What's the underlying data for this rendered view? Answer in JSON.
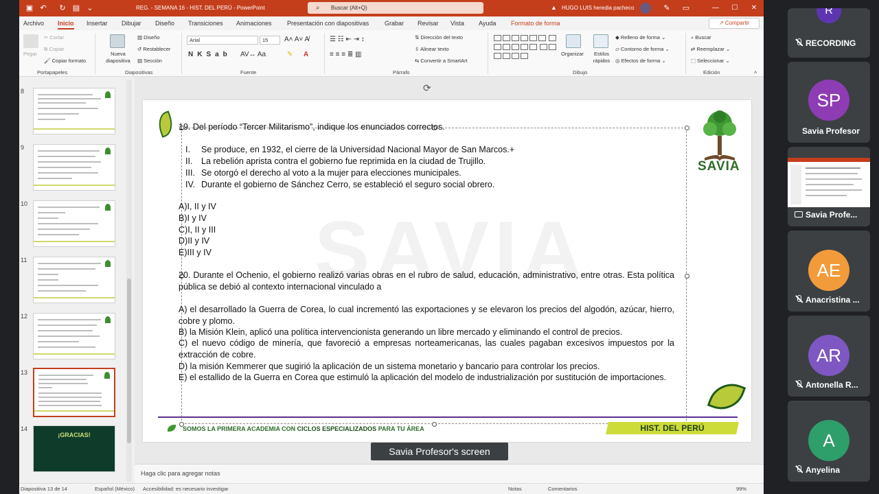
{
  "window": {
    "doc_title": "REG. - SEMANA 16 - HIST. DEL PERÚ  -  PowerPoint",
    "search_placeholder": "Buscar (Alt+Q)",
    "user_name": "HUGO LUIS heredia pacheco"
  },
  "ribbon": {
    "tabs": [
      "Archivo",
      "Inicio",
      "Insertar",
      "Dibujar",
      "Diseño",
      "Transiciones",
      "Animaciones",
      "Presentación con diapositivas",
      "Grabar",
      "Revisar",
      "Vista",
      "Ayuda",
      "Formato de forma"
    ],
    "share_label": "Compartir",
    "clipboard": {
      "paste": "Pegar",
      "cut": "Cortar",
      "copy": "Copiar",
      "format_painter": "Copiar formato",
      "group": "Portapapeles"
    },
    "slides": {
      "new_slide": "Nueva diapositiva",
      "layout": "Diseño",
      "reset": "Restablecer",
      "section": "Sección",
      "group": "Diapositivas"
    },
    "font": {
      "name": "Arial",
      "size": "15",
      "group": "Fuente"
    },
    "paragraph": {
      "text_direction": "Dirección del texto",
      "align_text": "Alinear texto",
      "smartart": "Convertir a SmartArt",
      "group": "Párrafo"
    },
    "drawing": {
      "arrange": "Organizar",
      "quick_styles": "Estilos rápidos",
      "shape_fill": "Relleno de forma",
      "shape_outline": "Contorno de forma",
      "shape_effects": "Efectos de forma",
      "group": "Dibujo"
    },
    "editing": {
      "find": "Buscar",
      "replace": "Reemplazar",
      "select": "Seleccionar",
      "group": "Edición"
    }
  },
  "thumbnails": {
    "numbers": [
      "8",
      "9",
      "10",
      "11",
      "12",
      "13",
      "14"
    ],
    "selected": "13",
    "last_slide_text": "¡GRACIAS!"
  },
  "slide": {
    "watermark": "SAVIA",
    "logo_text": "SAVIA",
    "q19_title": "19. Del período “Tercer Militarismo”, indique los enunciados correctos.",
    "q19_statements": [
      {
        "num": "I.",
        "text": "Se produce, en 1932, el cierre de la Universidad Nacional Mayor de San Marcos.+"
      },
      {
        "num": "II.",
        "text": "La rebelión aprista contra el gobierno fue  reprimida en la ciudad de Trujillo."
      },
      {
        "num": "III.",
        "text": "Se otorgó el derecho al voto a la mujer para elecciones municipales."
      },
      {
        "num": "IV.",
        "text": "Durante el gobierno de Sánchez Cerro, se  estableció el seguro social obrero."
      }
    ],
    "q19_options": [
      "A)I, II y IV",
      "B)I y IV",
      "C)I, II y III",
      "D)II y IV",
      "E)III y IV"
    ],
    "q20_title": "20. Durante el Ochenio, el gobierno realizó varias obras en el rubro de salud, educación, administrativo, entre otras. Esta política pública se debió al contexto internacional vinculado a",
    "q20_options": [
      "A) el desarrollado la Guerra de Corea, lo cual incrementó las exportaciones y se elevaron los precios del algodón, azúcar, hierro, cobre y plomo.",
      "B) la Misión Klein, aplicó una política intervencionista generando un libre mercado y eliminando el control de precios.",
      "C) el nuevo código de minería, que favoreció a empresas norteamericanas, las cuales pagaban excesivos impuestos por la extracción de cobre.",
      "D) la misión Kemmerer que sugirió la aplicación de un sistema monetario y bancario para controlar los precios.",
      "E) el estallido de la Guerra en Corea que estimuló la aplicación del modelo de industrialización por sustitución de importaciones."
    ],
    "footer_left_1": "SOMOS LA PRIMERA ACADEMIA CON ",
    "footer_left_2": "CICLOS ESPECIALIZADOS",
    "footer_left_3": " PARA TU ÁREA",
    "footer_right": "HIST. DEL PERÚ"
  },
  "notes_placeholder": "Haga clic para agregar notas",
  "statusbar": {
    "slide_info": "Diapositiva 13 de 14",
    "language": "Español (México)",
    "accessibility": "Accesibilidad: es necesario investigar",
    "notes": "Notas",
    "comments": "Comentarios",
    "zoom": "99%"
  },
  "meeting": {
    "share_label": "Savia Profesor's screen",
    "recording_label": "RECORDING",
    "recording_avatar": "R",
    "participants": [
      {
        "initials": "SP",
        "name": "Savia Profesor",
        "color": "#8e3cb4"
      },
      {
        "initials": "",
        "name": "Savia Profe...",
        "color": "#3c4043"
      },
      {
        "initials": "AE",
        "name": "Anacristina ...",
        "color": "#f29b3b"
      },
      {
        "initials": "AR",
        "name": "Antonella R...",
        "color": "#7e57c2"
      },
      {
        "initials": "A",
        "name": "Anyelina",
        "color": "#2e9e6b"
      }
    ]
  }
}
